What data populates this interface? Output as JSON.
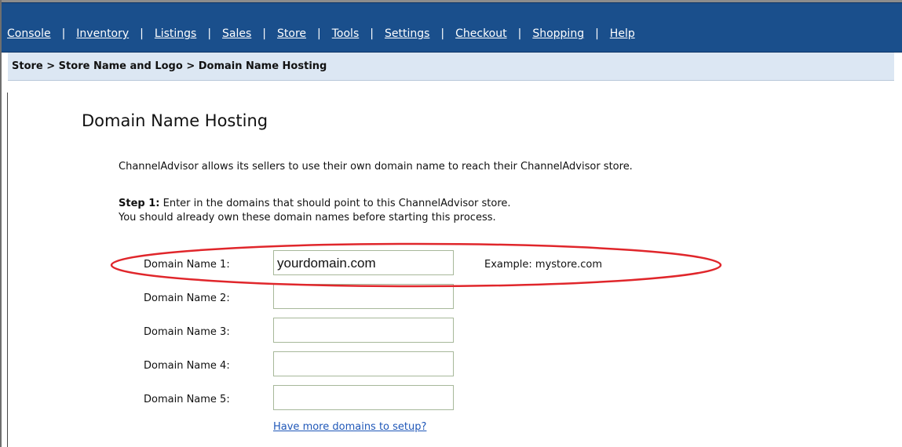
{
  "nav": {
    "items": [
      {
        "label": "Console"
      },
      {
        "label": "Inventory"
      },
      {
        "label": "Listings"
      },
      {
        "label": "Sales"
      },
      {
        "label": "Store"
      },
      {
        "label": "Tools"
      },
      {
        "label": "Settings"
      },
      {
        "label": "Checkout"
      },
      {
        "label": "Shopping"
      },
      {
        "label": "Help"
      }
    ],
    "separator": "|"
  },
  "breadcrumb": "Store > Store Name and Logo > Domain Name Hosting",
  "page": {
    "title": "Domain Name Hosting",
    "intro": "ChannelAdvisor allows its sellers to use their own domain name to reach their ChannelAdvisor store.",
    "step1_label": "Step 1:",
    "step1_text": " Enter in the domains that should point to this ChannelAdvisor store.",
    "step1_note": "You should already own these domain names before starting this process."
  },
  "domains": [
    {
      "label": "Domain Name 1:",
      "value": "yourdomain.com"
    },
    {
      "label": "Domain Name 2:",
      "value": ""
    },
    {
      "label": "Domain Name 3:",
      "value": ""
    },
    {
      "label": "Domain Name 4:",
      "value": ""
    },
    {
      "label": "Domain Name 5:",
      "value": ""
    }
  ],
  "example_text": "Example: mystore.com",
  "more_domains_link": "Have more domains to setup?",
  "colors": {
    "nav_background": "#1a4f8c",
    "breadcrumb_background": "#dce7f3",
    "highlight": "#e0262b",
    "link": "#1f57b8"
  }
}
